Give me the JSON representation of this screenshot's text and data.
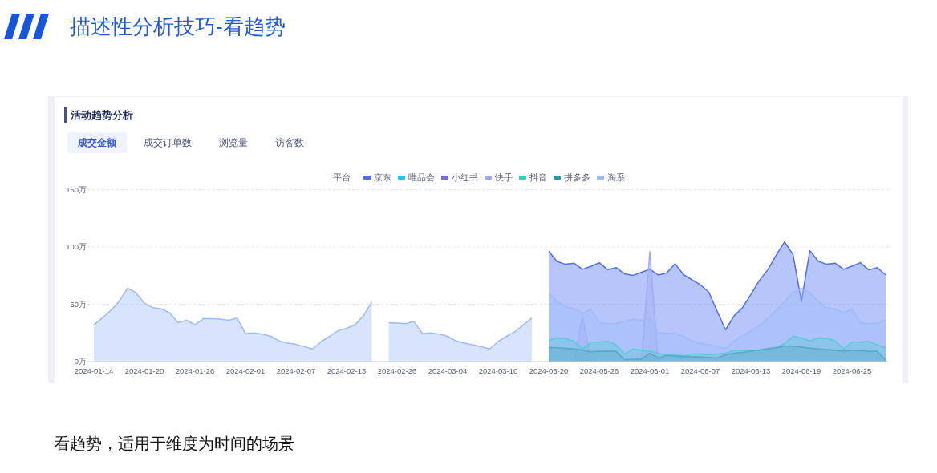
{
  "header": {
    "title": "描述性分析技巧-看趋势"
  },
  "panel": {
    "title": "活动趋势分析",
    "tabs": [
      {
        "label": "成交金额",
        "selected": true
      },
      {
        "label": "成交订单数",
        "selected": false
      },
      {
        "label": "浏览量",
        "selected": false
      },
      {
        "label": "访客数",
        "selected": false
      }
    ],
    "legend_title": "平台",
    "chart_data": {
      "type": "area",
      "stacked": false,
      "ylim": [
        0,
        150
      ],
      "yticks": [
        {
          "value": 0,
          "label": "0万"
        },
        {
          "value": 50,
          "label": "50万"
        },
        {
          "value": 100,
          "label": "100万"
        },
        {
          "value": 150,
          "label": "150万"
        }
      ],
      "categories": [
        "2024-01-14",
        null,
        null,
        null,
        null,
        null,
        "2024-01-20",
        null,
        null,
        null,
        null,
        null,
        "2024-01-26",
        null,
        null,
        null,
        null,
        null,
        "2024-02-01",
        null,
        null,
        null,
        null,
        null,
        "2024-02-07",
        null,
        null,
        null,
        null,
        null,
        "2024-02-13",
        null,
        null,
        null,
        null,
        null,
        "2024-02-26",
        null,
        null,
        null,
        null,
        null,
        "2024-03-04",
        null,
        null,
        null,
        null,
        null,
        "2024-03-10",
        null,
        null,
        null,
        null,
        null,
        "2024-05-20",
        null,
        null,
        null,
        null,
        null,
        "2024-05-26",
        null,
        null,
        null,
        null,
        null,
        "2024-06-01",
        null,
        null,
        null,
        null,
        null,
        "2024-06-07",
        null,
        null,
        null,
        null,
        null,
        "2024-06-13",
        null,
        null,
        null,
        null,
        null,
        "2024-06-19",
        null,
        null,
        null,
        null,
        null,
        "2024-06-25",
        null,
        null,
        null,
        null
      ],
      "series": [
        {
          "name": "京东",
          "color": "#4e6ef2",
          "values": [
            null,
            null,
            null,
            null,
            null,
            null,
            null,
            null,
            null,
            null,
            null,
            null,
            null,
            null,
            null,
            null,
            null,
            null,
            null,
            null,
            null,
            null,
            null,
            null,
            null,
            null,
            null,
            null,
            null,
            null,
            null,
            null,
            null,
            null,
            null,
            null,
            null,
            null,
            null,
            null,
            null,
            null,
            null,
            null,
            null,
            null,
            null,
            null,
            null,
            null,
            null,
            null,
            null,
            null,
            96.3,
            87.3,
            84.9,
            85.9,
            80.5,
            83,
            86.3,
            80.2,
            82,
            76.6,
            75.1,
            78,
            80.5,
            75.6,
            77.3,
            85.4,
            75.9,
            71.5,
            67,
            60.7,
            43.9,
            27.6,
            39.8,
            47,
            58.5,
            70.7,
            80,
            92.7,
            104.4,
            93.4,
            52.4,
            96.8,
            87.6,
            84.9,
            85.9,
            80.5,
            83.2,
            86.3,
            80,
            82,
            75.5
          ]
        },
        {
          "name": "唯品会",
          "color": "#19c9f0",
          "values": [
            null,
            null,
            null,
            null,
            null,
            null,
            null,
            null,
            null,
            null,
            null,
            null,
            null,
            null,
            null,
            null,
            null,
            null,
            null,
            null,
            null,
            null,
            null,
            null,
            null,
            null,
            null,
            null,
            null,
            null,
            null,
            null,
            null,
            null,
            null,
            null,
            null,
            null,
            null,
            null,
            null,
            null,
            null,
            null,
            null,
            null,
            null,
            null,
            null,
            null,
            null,
            null,
            null,
            null,
            null,
            null,
            null,
            null,
            null,
            null,
            null,
            null,
            null,
            null,
            null,
            null,
            null,
            null,
            null,
            null,
            null,
            null,
            null,
            null,
            null,
            null,
            null,
            null,
            null,
            null,
            null,
            null,
            null,
            null,
            null,
            null,
            null,
            null,
            null,
            null,
            null,
            null,
            null,
            null,
            null
          ]
        },
        {
          "name": "小红书",
          "color": "#8063db",
          "values": [
            null,
            null,
            null,
            null,
            null,
            null,
            null,
            null,
            null,
            null,
            null,
            null,
            null,
            null,
            null,
            null,
            null,
            null,
            null,
            null,
            null,
            null,
            null,
            null,
            null,
            null,
            null,
            null,
            null,
            null,
            null,
            null,
            null,
            null,
            null,
            null,
            null,
            null,
            null,
            null,
            null,
            null,
            null,
            null,
            null,
            null,
            null,
            null,
            null,
            null,
            null,
            null,
            null,
            null,
            null,
            null,
            null,
            null,
            null,
            null,
            null,
            null,
            null,
            null,
            null,
            null,
            null,
            null,
            null,
            null,
            null,
            null,
            null,
            null,
            null,
            null,
            null,
            null,
            null,
            null,
            null,
            null,
            null,
            null,
            null,
            null,
            null,
            null,
            null,
            null,
            null,
            null,
            null,
            null,
            null
          ]
        },
        {
          "name": "快手",
          "color": "#a3a9f8",
          "values": [
            null,
            null,
            null,
            null,
            null,
            null,
            null,
            null,
            null,
            null,
            null,
            null,
            null,
            null,
            null,
            null,
            null,
            null,
            null,
            null,
            null,
            null,
            null,
            null,
            null,
            null,
            null,
            null,
            null,
            null,
            null,
            null,
            null,
            null,
            null,
            null,
            null,
            null,
            null,
            null,
            null,
            null,
            null,
            null,
            null,
            null,
            null,
            null,
            null,
            null,
            null,
            null,
            null,
            null,
            0,
            0,
            0,
            0,
            40,
            0,
            0,
            0,
            0,
            0,
            0,
            0,
            96,
            0,
            0,
            0,
            0,
            0,
            0,
            0,
            0,
            0,
            0,
            0,
            0,
            0,
            0,
            0,
            0,
            0,
            0,
            0,
            0,
            0,
            0,
            0,
            0,
            0,
            0,
            0,
            0
          ]
        },
        {
          "name": "抖音",
          "color": "#2bd4bc",
          "values": [
            null,
            null,
            null,
            null,
            null,
            null,
            null,
            null,
            null,
            null,
            null,
            null,
            null,
            null,
            null,
            null,
            null,
            null,
            null,
            null,
            null,
            null,
            null,
            null,
            null,
            null,
            null,
            null,
            null,
            null,
            null,
            null,
            null,
            null,
            null,
            null,
            null,
            null,
            null,
            null,
            null,
            null,
            null,
            null,
            null,
            null,
            null,
            null,
            null,
            null,
            null,
            null,
            null,
            null,
            18.3,
            20.7,
            20.2,
            17.8,
            11,
            17,
            17,
            17.6,
            14.6,
            6.6,
            11,
            9.8,
            9,
            7.3,
            5.6,
            6,
            4.9,
            6.6,
            6.6,
            6,
            6.6,
            7.3,
            9.8,
            9.8,
            9.8,
            10.2,
            11.5,
            12.2,
            15.9,
            22,
            20.7,
            17.8,
            20.7,
            20.2,
            18.3,
            11,
            17,
            17,
            17.6,
            14.6,
            12
          ]
        },
        {
          "name": "拼多多",
          "color": "#2a98a8",
          "values": [
            null,
            null,
            null,
            null,
            null,
            null,
            null,
            null,
            null,
            null,
            null,
            null,
            null,
            null,
            null,
            null,
            null,
            null,
            null,
            null,
            null,
            null,
            null,
            null,
            null,
            null,
            null,
            null,
            null,
            null,
            null,
            null,
            null,
            null,
            null,
            null,
            null,
            null,
            null,
            null,
            null,
            null,
            null,
            null,
            null,
            null,
            null,
            null,
            null,
            null,
            null,
            null,
            null,
            null,
            12.2,
            12,
            11.5,
            11,
            10,
            8.5,
            9,
            9.3,
            9,
            1.7,
            2,
            2,
            7.3,
            3.2,
            5.4,
            4.9,
            4.5,
            4.2,
            4,
            3.7,
            3.2,
            6,
            7.3,
            8,
            9,
            10,
            11,
            12,
            13.4,
            13.4,
            12.5,
            11.7,
            11,
            10.5,
            9.8,
            9,
            9.8,
            9.5,
            9,
            9,
            1.5
          ]
        },
        {
          "name": "淘系",
          "color": "#9dbbfb",
          "values": [
            32,
            38,
            44.5,
            52.5,
            64,
            60,
            51,
            47,
            46,
            42.5,
            34,
            36,
            32,
            37.5,
            37.5,
            37,
            36,
            38,
            24.5,
            25,
            24,
            22,
            18,
            16,
            15,
            13,
            11,
            17.5,
            22,
            27,
            29,
            32,
            40,
            52,
            null,
            34,
            33.5,
            33,
            35,
            24.5,
            25,
            24,
            22,
            18,
            16,
            14.5,
            13,
            11,
            17.5,
            22,
            26,
            32,
            38,
            null,
            59.8,
            52.4,
            47.6,
            46,
            42,
            45.6,
            34,
            33,
            33.4,
            35,
            37,
            36,
            38,
            25,
            25,
            24.4,
            22,
            17.8,
            15.9,
            14.6,
            13.4,
            11.5,
            17.8,
            22.7,
            26.6,
            31.2,
            38,
            45,
            52.4,
            60.3,
            64,
            60.3,
            52.4,
            47,
            46,
            42.7,
            45.6,
            34,
            33,
            33.4,
            36
          ]
        }
      ]
    }
  },
  "caption": "看趋势，适用于维度为时间的场景"
}
